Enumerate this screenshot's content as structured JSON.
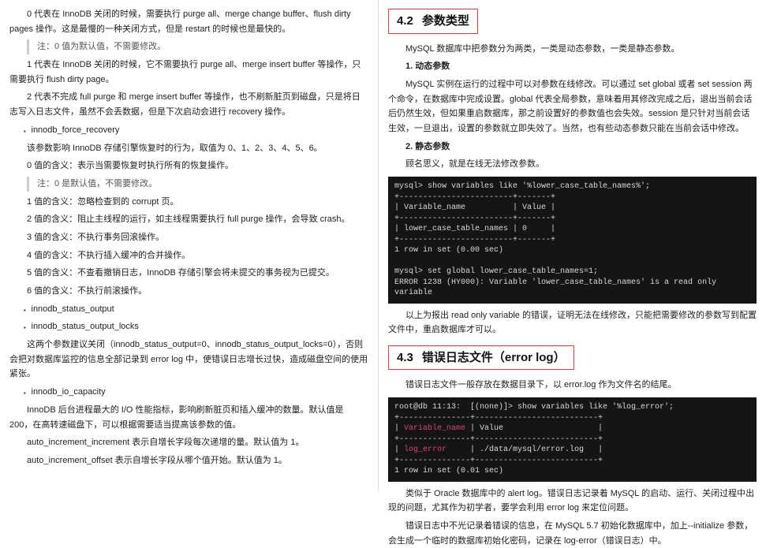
{
  "left": {
    "p1": "0 代表在 InnoDB 关闭的时候，需要执行 purge all、merge change buffer、flush dirty pages 操作。这是最慢的一种关闭方式，但是 restart 的时候也是最快的。",
    "note1": "注：0 值为默认值，不需要修改。",
    "p2": "1 代表在 InnoDB 关闭的时候，它不需要执行 purge all、merge insert buffer 等操作，只需要执行 flush dirty page。",
    "p3": "2 代表不完成 full purge 和 merge insert buffer 等操作，也不刷新脏页到磁盘，只是将日志写入日志文件，虽然不会丢数据，但是下次启动会进行 recovery 操作。",
    "b1": "innodb_force_recovery",
    "p4": "该参数影响 InnoDB 存储引擎恢复时的行为，取值为 0、1、2、3、4、5、6。",
    "p5": "0 值的含义：表示当需要恢复时执行所有的恢复操作。",
    "note2": "注：0 是默认值，不需要修改。",
    "p6": "1 值的含义：忽略检查到的 corrupt 页。",
    "p7": "2 值的含义：阻止主线程的运行，如主线程需要执行 full purge 操作，会导致 crash。",
    "p8": "3 值的含义：不执行事务回滚操作。",
    "p9": "4 值的含义：不执行插入缓冲的合并操作。",
    "p10": "5 值的含义：不查看撤销日志，InnoDB 存储引擎会将未提交的事务视为已提交。",
    "p11": "6 值的含义：不执行前滚操作。",
    "b2": "innodb_status_output",
    "b3": "innodb_status_output_locks",
    "p12": "这两个参数建议关闭（innodb_status_output=0、innodb_status_output_locks=0），否则会把对数据库监控的信息全部记录到 error log 中，使错误日志增长过快，造成磁盘空间的使用紧张。",
    "b4": "innodb_io_capacity",
    "p13": "InnoDB 后台进程最大的 I/O 性能指标，影响刷新脏页和插入缓冲的数量。默认值是 200，在高转速磁盘下，可以根据需要适当提高该参数的值。",
    "p14": "auto_increment_increment 表示自增长字段每次递增的量。默认值为 1。",
    "p15": "auto_increment_offset 表示自增长字段从哪个值开始。默认值为 1。"
  },
  "right": {
    "h42num": "4.2",
    "h42txt": "参数类型",
    "p1": "MySQL 数据库中把参数分为两类，一类是动态参数，一类是静态参数。",
    "sub1": "1. 动态参数",
    "p2": "MySQL 实例在运行的过程中可以对参数在线修改。可以通过 set global 或者 set session 两个命令，在数据库中完成设置。global 代表全局参数，意味着用其修改完成之后，退出当前会话后仍然生效，但如果重启数据库，那之前设置好的参数值也会失效。session 是只针对当前会话生效，一旦退出，设置的参数就立即失效了。当然，也有些动态参数只能在当前会话中修改。",
    "sub2": "2. 静态参数",
    "p3": "顾名思义，就是在线无法修改参数。",
    "term1": "mysql> show variables like '%lower_case_table_names%';\n+------------------------+-------+\n| Variable_name          | Value |\n+------------------------+-------+\n| lower_case_table_names | 0     |\n+------------------------+-------+\n1 row in set (0.00 sec)\n\nmysql> set global lower_case_table_names=1;\nERROR 1238 (HY000): Variable 'lower_case_table_names' is a read only variable",
    "p4": "以上为报出 read only variable 的错误，证明无法在线修改，只能把需要修改的参数写到配置文件中，重启数据库才可以。",
    "h43num": "4.3",
    "h43txt": "错误日志文件（error log）",
    "p5": "错误日志文件一般存放在数据目录下，以 error.log 作为文件名的结尾。",
    "term2_a": "root@db 11:13:  [(none)]> show variables like '%log_error';\n+---------------+--------------------------+\n| ",
    "term2_var": "Variable_name",
    "term2_b": " | Value                    |\n+---------------+--------------------------+\n| ",
    "term2_log": "log_error",
    "term2_c": "     | ./data/mysql/error.log   |\n+---------------+--------------------------+\n1 row in set (0.01 sec)",
    "p6": "类似于 Oracle 数据库中的 alert log。错误日志记录着 MySQL 的启动、运行、关闭过程中出现的问题，尤其作为初学者，要学会利用 error log 来定位问题。",
    "p7": "错误日志中不光记录着错误的信息，在 MySQL 5.7 初始化数据库中，加上--initialize 参数，会生成一个临时的数据库初始化密码，记录在 log-error（错误日志）中。"
  }
}
